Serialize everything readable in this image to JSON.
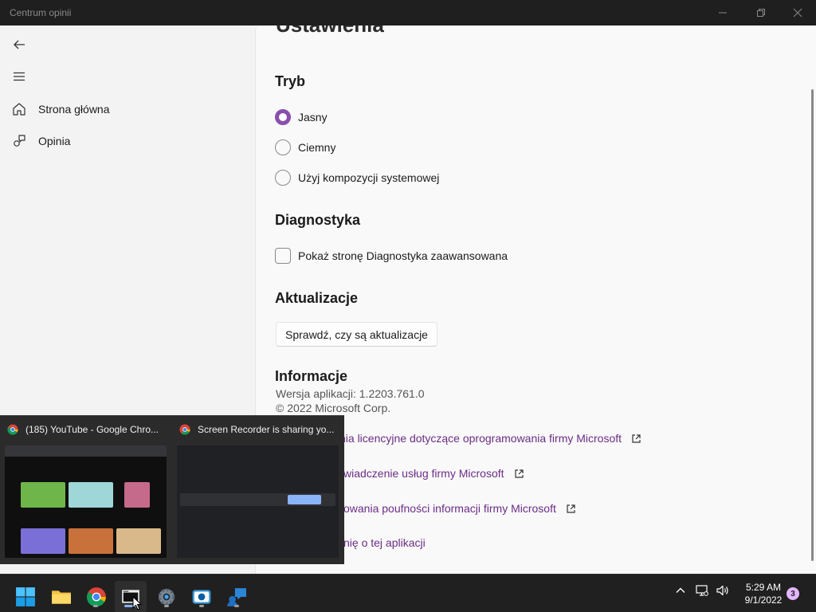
{
  "window": {
    "title": "Centrum opinii"
  },
  "nav": {
    "items": [
      {
        "label": "Strona główna",
        "icon": "home-icon"
      },
      {
        "label": "Opinia",
        "icon": "feedback-icon"
      }
    ]
  },
  "content": {
    "page_title": "Ustawienia",
    "mode": {
      "heading": "Tryb",
      "options": [
        {
          "label": "Jasny",
          "selected": true
        },
        {
          "label": "Ciemny",
          "selected": false
        },
        {
          "label": "Użyj kompozycji systemowej",
          "selected": false
        }
      ]
    },
    "diagnostics": {
      "heading": "Diagnostyka",
      "checkbox_label": "Pokaż stronę Diagnostyka zaawansowana",
      "checked": false
    },
    "updates": {
      "heading": "Aktualizacje",
      "button_label": "Sprawdź, czy są aktualizacje"
    },
    "info": {
      "heading": "Informacje",
      "version": "Wersja aplikacji: 1.2203.761.0",
      "copyright": "© 2022 Microsoft Corp.",
      "links": [
        "nia licencyjne dotyczące oprogramowania firmy Microsoft",
        "wiadczenie usług firmy Microsoft",
        "owania poufności informacji firmy Microsoft",
        "nię o tej aplikacji"
      ]
    }
  },
  "taskbar_preview": {
    "windows": [
      {
        "title": "(185) YouTube - Google Chro..."
      },
      {
        "title": "Screen Recorder is sharing yo..."
      }
    ]
  },
  "taskbar": {
    "apps": [
      "start-icon",
      "file-explorer-icon",
      "chrome-icon",
      "screen-recorder-icon",
      "settings-icon",
      "camera-icon",
      "feedback-hub-icon"
    ],
    "clock_time": "5:29 AM",
    "clock_date": "9/1/2022",
    "notification_count": "3",
    "accent": "#8a4fae"
  }
}
